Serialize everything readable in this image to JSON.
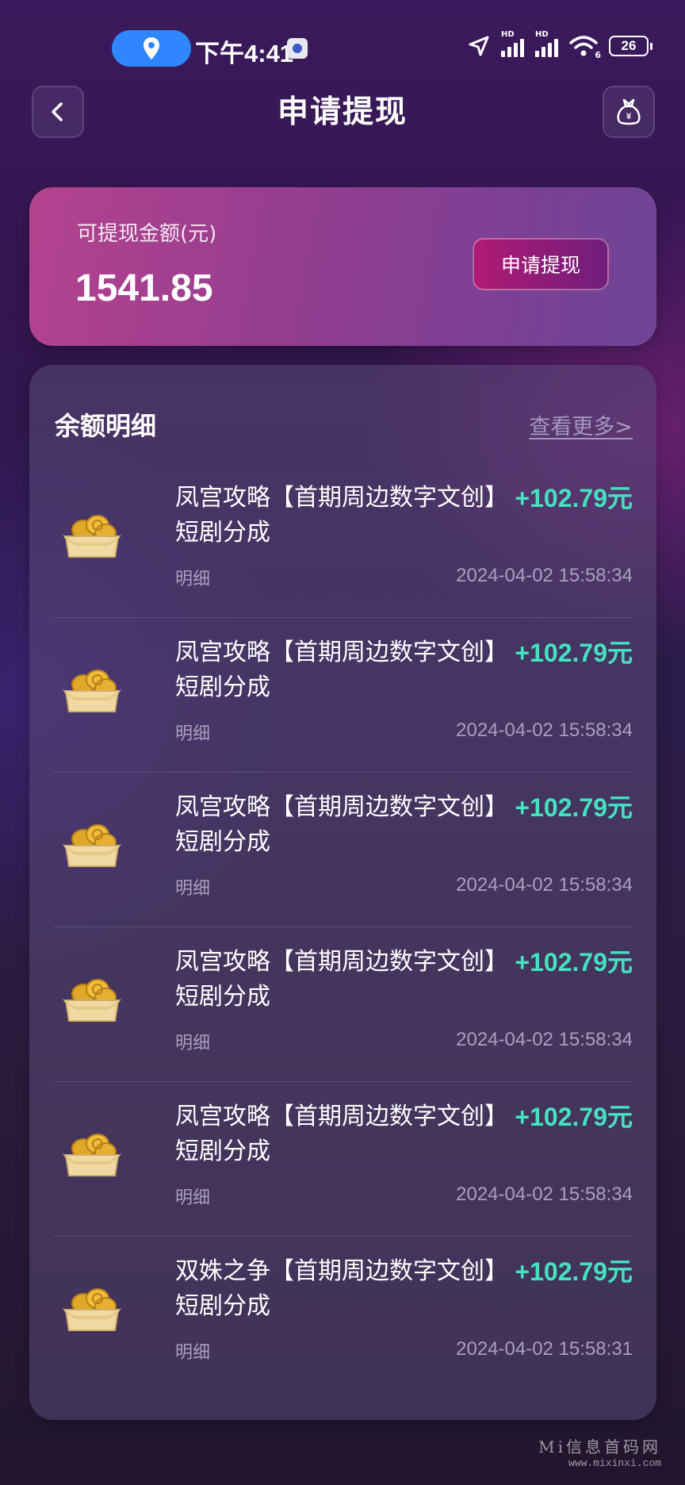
{
  "status_bar": {
    "time": "下午4:41",
    "signal1_label": "HD",
    "signal2_label": "HD",
    "wifi_label": "6",
    "battery": "26"
  },
  "header": {
    "title": "申请提现",
    "back_icon": "chevron-left-icon",
    "right_icon": "money-bag-icon",
    "right_icon_symbol": "¥"
  },
  "balance": {
    "label": "可提现金额(元)",
    "amount": "1541.85",
    "button_label": "申请提现"
  },
  "details": {
    "title": "余额明细",
    "view_more": "查看更多>",
    "items": [
      {
        "title": "凤宫攻略【首期周边数字文创】短剧分成",
        "amount": "+102.79元",
        "sub": "明细",
        "time": "2024-04-02 15:58:34"
      },
      {
        "title": "凤宫攻略【首期周边数字文创】短剧分成",
        "amount": "+102.79元",
        "sub": "明细",
        "time": "2024-04-02 15:58:34"
      },
      {
        "title": "凤宫攻略【首期周边数字文创】短剧分成",
        "amount": "+102.79元",
        "sub": "明细",
        "time": "2024-04-02 15:58:34"
      },
      {
        "title": "凤宫攻略【首期周边数字文创】短剧分成",
        "amount": "+102.79元",
        "sub": "明细",
        "time": "2024-04-02 15:58:34"
      },
      {
        "title": "凤宫攻略【首期周边数字文创】短剧分成",
        "amount": "+102.79元",
        "sub": "明细",
        "time": "2024-04-02 15:58:34"
      },
      {
        "title": "双姝之争【首期周边数字文创】短剧分成",
        "amount": "+102.79元",
        "sub": "明细",
        "time": "2024-04-02 15:58:31"
      }
    ]
  },
  "watermark": {
    "name": "Mi信息首码网",
    "url": "www.mixinxi.com"
  },
  "colors": {
    "accent_green": "#45e2c0",
    "card_pink": "#b4438f",
    "button_magenta": "#b01a74",
    "location_blue": "#2f86ff"
  }
}
